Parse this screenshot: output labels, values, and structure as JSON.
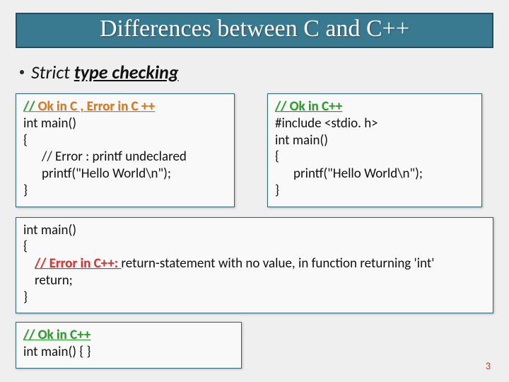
{
  "title": "Differences between C and C++",
  "bullet": {
    "pre": "Strict ",
    "emph": "type checking"
  },
  "box1": {
    "hdr_pre": "//  ",
    "hdr_rest": "Ok in C , Error in C ++",
    "l1": "int main()",
    "l2": "{",
    "l3": "// Error : printf undeclared",
    "l4": "printf(\"Hello World\\n\");",
    "l5": "}"
  },
  "box2": {
    "hdr_pre": "//  ",
    "hdr_rest": "Ok in C++",
    "l1": "#include <stdio. h>",
    "l2": "int main()",
    "l3": "{",
    "l4": "printf(\"Hello World\\n\");",
    "l5": "}"
  },
  "box3": {
    "l1": "int main()",
    "l2": "{",
    "err_pre": "// Error  ",
    "err_mid": "in C++: ",
    "err_post": "return-statement with no value, in function returning 'int'",
    "l4": "return;",
    "l5": "}"
  },
  "box4": {
    "hdr_pre": "//  ",
    "hdr_rest": "Ok in C++",
    "l1": "int main() { }"
  },
  "page": "3"
}
